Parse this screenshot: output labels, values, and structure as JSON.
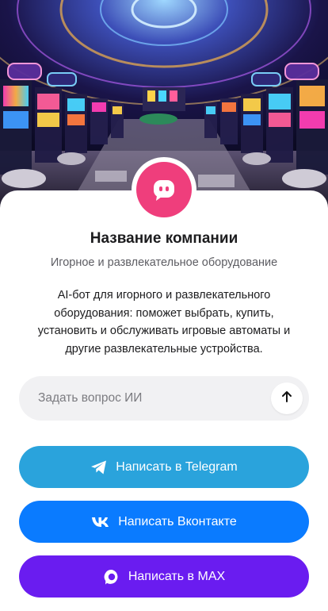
{
  "company": {
    "name": "Название компании",
    "subtitle": "Игорное и развлекательное оборудование",
    "description": "AI-бот для игорного и развлекательного оборудования: поможет выбрать, купить, установить и обслуживать игровые автоматы и другие развлекательные устройства."
  },
  "ask": {
    "placeholder": "Задать вопрос ИИ"
  },
  "buttons": {
    "telegram": "Написать в Telegram",
    "vk": "Написать Вконтакте",
    "max": "Написать в MAX"
  },
  "colors": {
    "avatar": "#ef3e7c",
    "telegram": "#2aa3dc",
    "vk": "#0a7bff",
    "max": "#6a1cf0"
  },
  "icons": {
    "avatar": "chat-bot-icon",
    "send": "arrow-up-icon",
    "telegram": "telegram-icon",
    "vk": "vk-icon",
    "max": "max-icon"
  }
}
